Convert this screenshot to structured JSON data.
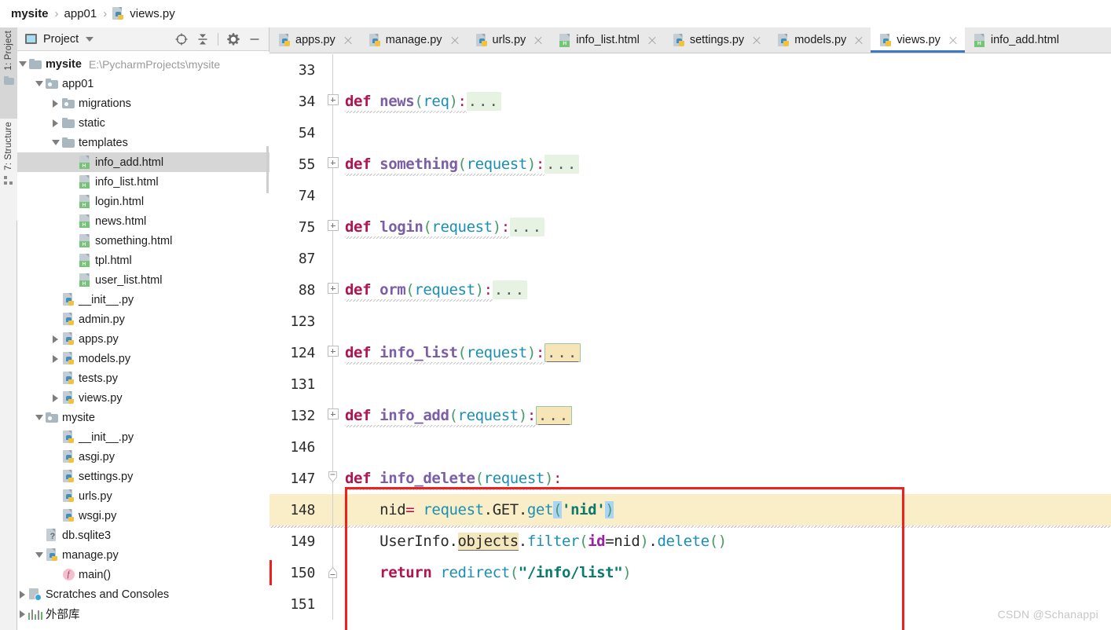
{
  "breadcrumb": {
    "items": [
      {
        "label": "mysite",
        "bold": true,
        "icon": "none"
      },
      {
        "label": "app01",
        "bold": false,
        "icon": "none"
      },
      {
        "label": "views.py",
        "bold": false,
        "icon": "python-file-icon"
      }
    ],
    "separator": "›"
  },
  "tool_rail": {
    "tabs": [
      {
        "label": "1: Project",
        "icon": "folder-icon",
        "active": true
      },
      {
        "label": "7: Structure",
        "icon": "structure-icon",
        "active": false
      }
    ]
  },
  "project_panel": {
    "title": "Project",
    "title_icon": "project-window-icon",
    "dropdown_icon": "chevron-down-icon",
    "toolbar": [
      {
        "name": "locate-icon",
        "tooltip": "Select Opened File"
      },
      {
        "name": "collapse-all-icon",
        "tooltip": "Collapse All"
      },
      {
        "name": "gear-icon",
        "tooltip": "Settings"
      },
      {
        "name": "minimize-icon",
        "tooltip": "Hide"
      }
    ],
    "tree": [
      {
        "label": "mysite",
        "path": "E:\\PycharmProjects\\mysite",
        "indent": 0,
        "twisty": "open",
        "icon": "folder",
        "bold": true,
        "selected": false
      },
      {
        "label": "app01",
        "path": "",
        "indent": 1,
        "twisty": "open",
        "icon": "folder-module",
        "bold": false,
        "selected": false
      },
      {
        "label": "migrations",
        "path": "",
        "indent": 2,
        "twisty": "closed",
        "icon": "folder-module",
        "bold": false,
        "selected": false
      },
      {
        "label": "static",
        "path": "",
        "indent": 2,
        "twisty": "closed",
        "icon": "folder",
        "bold": false,
        "selected": false
      },
      {
        "label": "templates",
        "path": "",
        "indent": 2,
        "twisty": "open",
        "icon": "folder",
        "bold": false,
        "selected": false
      },
      {
        "label": "info_add.html",
        "path": "",
        "indent": 3,
        "twisty": "none",
        "icon": "html",
        "bold": false,
        "selected": true
      },
      {
        "label": "info_list.html",
        "path": "",
        "indent": 3,
        "twisty": "none",
        "icon": "html",
        "bold": false,
        "selected": false
      },
      {
        "label": "login.html",
        "path": "",
        "indent": 3,
        "twisty": "none",
        "icon": "html",
        "bold": false,
        "selected": false
      },
      {
        "label": "news.html",
        "path": "",
        "indent": 3,
        "twisty": "none",
        "icon": "html",
        "bold": false,
        "selected": false
      },
      {
        "label": "something.html",
        "path": "",
        "indent": 3,
        "twisty": "none",
        "icon": "html",
        "bold": false,
        "selected": false
      },
      {
        "label": "tpl.html",
        "path": "",
        "indent": 3,
        "twisty": "none",
        "icon": "html",
        "bold": false,
        "selected": false
      },
      {
        "label": "user_list.html",
        "path": "",
        "indent": 3,
        "twisty": "none",
        "icon": "html",
        "bold": false,
        "selected": false
      },
      {
        "label": "__init__.py",
        "path": "",
        "indent": 2,
        "twisty": "none",
        "icon": "python",
        "bold": false,
        "selected": false
      },
      {
        "label": "admin.py",
        "path": "",
        "indent": 2,
        "twisty": "none",
        "icon": "python",
        "bold": false,
        "selected": false
      },
      {
        "label": "apps.py",
        "path": "",
        "indent": 2,
        "twisty": "closed",
        "icon": "python",
        "bold": false,
        "selected": false
      },
      {
        "label": "models.py",
        "path": "",
        "indent": 2,
        "twisty": "closed",
        "icon": "python",
        "bold": false,
        "selected": false
      },
      {
        "label": "tests.py",
        "path": "",
        "indent": 2,
        "twisty": "none",
        "icon": "python",
        "bold": false,
        "selected": false
      },
      {
        "label": "views.py",
        "path": "",
        "indent": 2,
        "twisty": "closed",
        "icon": "python",
        "bold": false,
        "selected": false
      },
      {
        "label": "mysite",
        "path": "",
        "indent": 1,
        "twisty": "open",
        "icon": "folder-module",
        "bold": false,
        "selected": false
      },
      {
        "label": "__init__.py",
        "path": "",
        "indent": 2,
        "twisty": "none",
        "icon": "python",
        "bold": false,
        "selected": false
      },
      {
        "label": "asgi.py",
        "path": "",
        "indent": 2,
        "twisty": "none",
        "icon": "python",
        "bold": false,
        "selected": false
      },
      {
        "label": "settings.py",
        "path": "",
        "indent": 2,
        "twisty": "none",
        "icon": "python",
        "bold": false,
        "selected": false
      },
      {
        "label": "urls.py",
        "path": "",
        "indent": 2,
        "twisty": "none",
        "icon": "python",
        "bold": false,
        "selected": false
      },
      {
        "label": "wsgi.py",
        "path": "",
        "indent": 2,
        "twisty": "none",
        "icon": "python",
        "bold": false,
        "selected": false
      },
      {
        "label": "db.sqlite3",
        "path": "",
        "indent": 1,
        "twisty": "none",
        "icon": "db",
        "bold": false,
        "selected": false
      },
      {
        "label": "manage.py",
        "path": "",
        "indent": 1,
        "twisty": "open",
        "icon": "python",
        "bold": false,
        "selected": false
      },
      {
        "label": "main()",
        "path": "",
        "indent": 2,
        "twisty": "none",
        "icon": "function",
        "bold": false,
        "selected": false
      },
      {
        "label": "Scratches and Consoles",
        "path": "",
        "indent": 0,
        "twisty": "closed",
        "icon": "scratches",
        "bold": false,
        "selected": false
      },
      {
        "label": "外部库",
        "path": "",
        "indent": 0,
        "twisty": "closed",
        "icon": "library",
        "bold": false,
        "selected": false
      }
    ]
  },
  "editor": {
    "tabs": [
      {
        "label": "apps.py",
        "icon": "python-file-icon",
        "active": false,
        "closable": true
      },
      {
        "label": "manage.py",
        "icon": "python-file-icon",
        "active": false,
        "closable": true
      },
      {
        "label": "urls.py",
        "icon": "python-file-icon",
        "active": false,
        "closable": true
      },
      {
        "label": "info_list.html",
        "icon": "html-file-icon",
        "active": false,
        "closable": true
      },
      {
        "label": "settings.py",
        "icon": "python-file-icon",
        "active": false,
        "closable": true
      },
      {
        "label": "models.py",
        "icon": "python-file-icon",
        "active": false,
        "closable": true
      },
      {
        "label": "views.py",
        "icon": "python-file-icon",
        "active": true,
        "closable": true
      },
      {
        "label": "info_add.html",
        "icon": "html-file-icon",
        "active": false,
        "closable": false
      }
    ],
    "active_tab": "views.py",
    "lines": [
      {
        "num": "33",
        "kind": "blank",
        "fold": "line"
      },
      {
        "num": "34",
        "kind": "folded",
        "fold": "plus",
        "signature": "def news(req):",
        "name": "news",
        "arg": "req",
        "placeholder": "...",
        "placeholder_style": "green"
      },
      {
        "num": "54",
        "kind": "blank",
        "fold": "line"
      },
      {
        "num": "55",
        "kind": "folded",
        "fold": "plus",
        "signature": "def something(request):",
        "name": "something",
        "arg": "request",
        "placeholder": "...",
        "placeholder_style": "green"
      },
      {
        "num": "74",
        "kind": "blank",
        "fold": "line"
      },
      {
        "num": "75",
        "kind": "folded",
        "fold": "plus",
        "signature": "def login(request):",
        "name": "login",
        "arg": "request",
        "placeholder": "...",
        "placeholder_style": "green"
      },
      {
        "num": "87",
        "kind": "blank",
        "fold": "line"
      },
      {
        "num": "88",
        "kind": "folded",
        "fold": "plus",
        "signature": "def orm(request):",
        "name": "orm",
        "arg": "request",
        "placeholder": "...",
        "placeholder_style": "green"
      },
      {
        "num": "123",
        "kind": "blank",
        "fold": "line"
      },
      {
        "num": "124",
        "kind": "folded",
        "fold": "plus",
        "signature": "def info_list(request):",
        "name": "info_list",
        "arg": "request",
        "placeholder": "...",
        "placeholder_style": "warn"
      },
      {
        "num": "131",
        "kind": "blank",
        "fold": "line"
      },
      {
        "num": "132",
        "kind": "folded",
        "fold": "plus",
        "signature": "def info_add(request):",
        "name": "info_add",
        "arg": "request",
        "placeholder": "...",
        "placeholder_style": "warn"
      },
      {
        "num": "146",
        "kind": "blank",
        "fold": "line"
      },
      {
        "num": "147",
        "kind": "code",
        "fold": "region-start",
        "text": "def info_delete(request):",
        "highlighted": false
      },
      {
        "num": "148",
        "kind": "code",
        "fold": "none",
        "text": "    nid= request.GET.get('nid')",
        "highlighted": true
      },
      {
        "num": "149",
        "kind": "code",
        "fold": "none",
        "text": "    UserInfo.objects.filter(id=nid).delete()",
        "highlighted": false
      },
      {
        "num": "150",
        "kind": "code",
        "fold": "region-end",
        "text": "    return redirect(\"/info/list\")",
        "highlighted": false
      },
      {
        "num": "151",
        "kind": "blank",
        "fold": "line"
      }
    ],
    "current_line": "148",
    "annotation": {
      "type": "red-rectangle",
      "color": "#f2201c"
    }
  },
  "watermark": "CSDN @Schanappi",
  "colors": {
    "accent": "#3c7bbf",
    "selection": "#d6d6d6",
    "current_line": "#faeec8",
    "annotation_red": "#f2201c",
    "keyword": "#b3134f",
    "function_name": "#7b5ea8",
    "parameter": "#1a8fb5",
    "string": "#0a7a6e",
    "kwarg": "#9b1fa8",
    "fold_green": "#e6f3e3",
    "fold_warn": "#f6e5b6"
  }
}
